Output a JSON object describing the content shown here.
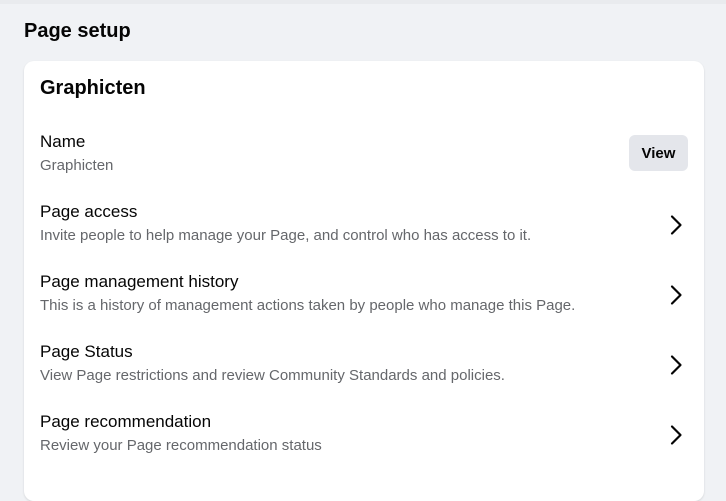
{
  "section": {
    "title": "Page setup"
  },
  "card": {
    "title": "Graphicten",
    "rows": [
      {
        "title": "Name",
        "subtitle": "Graphicten",
        "action_label": "View"
      },
      {
        "title": "Page access",
        "subtitle": "Invite people to help manage your Page, and control who has access to it.",
        "icon": "chevron-right-icon"
      },
      {
        "title": "Page management history",
        "subtitle": "This is a history of management actions taken by people who manage this Page.",
        "icon": "chevron-right-icon"
      },
      {
        "title": "Page Status",
        "subtitle": "View Page restrictions and review Community Standards and policies.",
        "icon": "chevron-right-icon"
      },
      {
        "title": "Page recommendation",
        "subtitle": "Review your Page recommendation status",
        "icon": "chevron-right-icon"
      }
    ]
  },
  "colors": {
    "background": "#f0f2f5",
    "card": "#ffffff",
    "secondary_text": "#65676b",
    "button_bg": "#e4e6eb"
  }
}
